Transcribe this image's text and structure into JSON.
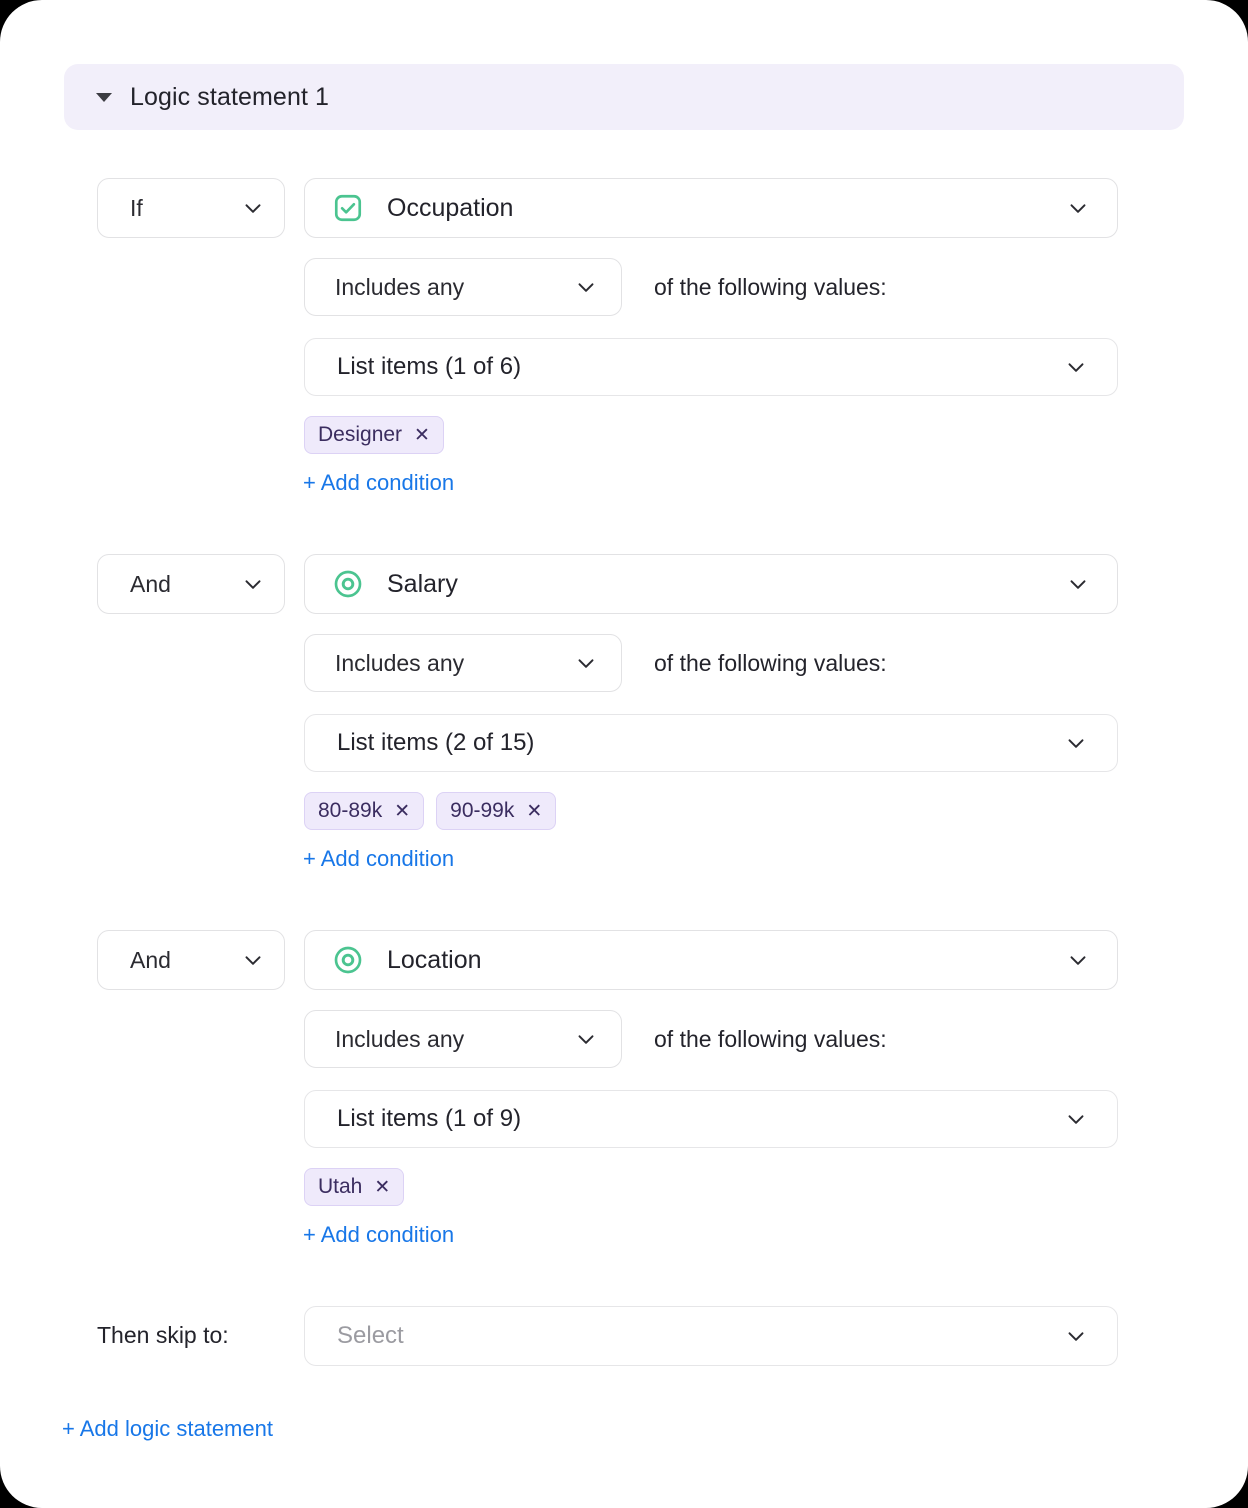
{
  "header": {
    "title": "Logic statement 1",
    "collapse_icon": "caret-down-icon",
    "background_color": "#F2EFFA"
  },
  "colors": {
    "link_blue": "#1877E8",
    "tag_background": "#EFEAFB",
    "tag_border": "#DCD2F5",
    "tag_text": "#3B2D60",
    "field_icon_green": "#4BC490",
    "header_lavender": "#F2EFFA"
  },
  "conditions": [
    {
      "connector": "If",
      "field": "Occupation",
      "field_icon": "checkbox-checked-icon",
      "operator": "Includes any",
      "operator_suffix": "of the following values:",
      "list_items_label": "List items (1 of 6)",
      "selected_count": 1,
      "total_count": 6,
      "tags": [
        "Designer"
      ],
      "add_condition_label": "+ Add condition"
    },
    {
      "connector": "And",
      "field": "Salary",
      "field_icon": "radio-button-icon",
      "operator": "Includes any",
      "operator_suffix": "of the following values:",
      "list_items_label": "List items (2 of 15)",
      "selected_count": 2,
      "total_count": 15,
      "tags": [
        "80-89k",
        "90-99k"
      ],
      "add_condition_label": "+ Add condition"
    },
    {
      "connector": "And",
      "field": "Location",
      "field_icon": "radio-button-icon",
      "operator": "Includes any",
      "operator_suffix": "of the following values:",
      "list_items_label": "List items (1 of 9)",
      "selected_count": 1,
      "total_count": 9,
      "tags": [
        "Utah"
      ],
      "add_condition_label": "+ Add condition"
    }
  ],
  "footer": {
    "skip_label": "Then skip to:",
    "skip_placeholder": "Select",
    "add_logic_statement_label": "+ Add logic statement"
  },
  "tag_remove_glyph": "✕"
}
